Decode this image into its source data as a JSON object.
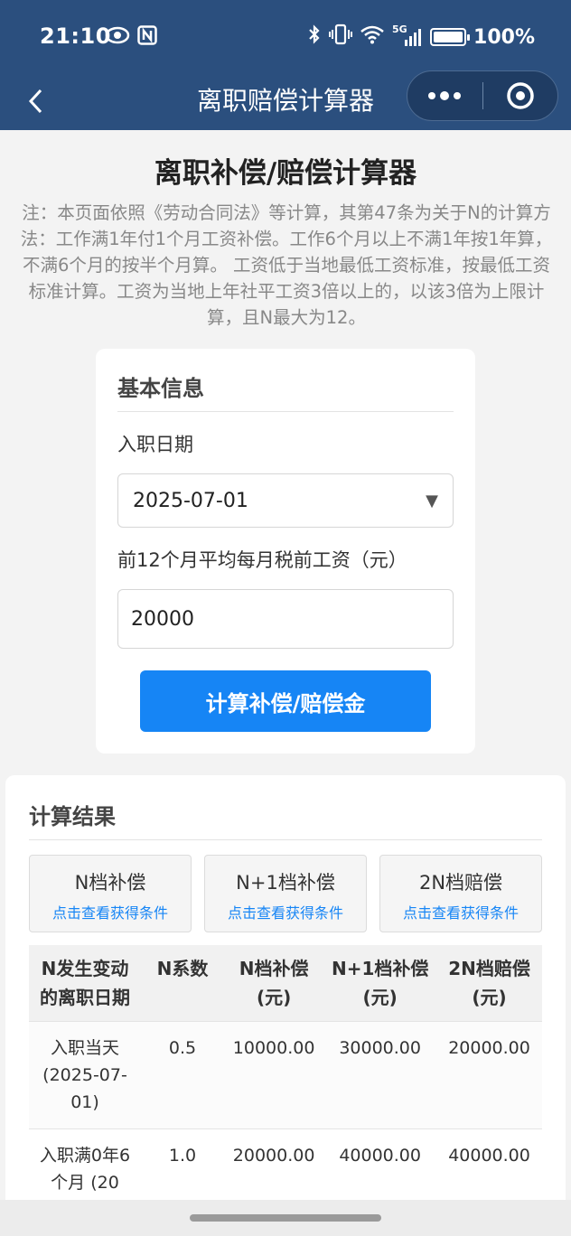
{
  "status_bar": {
    "time": "21:10",
    "network": "5G",
    "battery": "100%",
    "battery_level": 1.0,
    "icons": [
      "eye-icon",
      "nfc-icon",
      "bluetooth-icon",
      "vibrate-icon",
      "wifi-icon",
      "signal-icon",
      "battery-icon"
    ]
  },
  "nav": {
    "title": "离职赔偿计算器"
  },
  "page": {
    "title": "离职补偿/赔偿计算器",
    "note": "注：本页面依照《劳动合同法》等计算，其第47条为关于N的计算方法：工作满1年付1个月工资补偿。工作6个月以上不满1年按1年算，不满6个月的按半个月算。 工资低于当地最低工资标准，按最低工资标准计算。工资为当地上年社平工资3倍以上的，以该3倍为上限计算，且N最大为12。"
  },
  "basic": {
    "title": "基本信息",
    "hire_label": "入职日期",
    "hire_value": "2025-07-01",
    "salary_label": "前12个月平均每月税前工资（元）",
    "salary_value": "20000",
    "calc_button": "计算补偿/赔偿金"
  },
  "result": {
    "title": "计算结果",
    "tabs": [
      {
        "title": "N档补偿",
        "link": "点击查看获得条件"
      },
      {
        "title": "N+1档补偿",
        "link": "点击查看获得条件"
      },
      {
        "title": "2N档赔偿",
        "link": "点击查看获得条件"
      }
    ],
    "headers": [
      "N发生变动的离职日期",
      "N系数",
      "N档补偿(元)",
      "N+1档补偿(元)",
      "2N档赔偿(元)"
    ],
    "rows": [
      [
        "入职当天(2025-07-01)",
        "0.5",
        "10000.00",
        "30000.00",
        "20000.00"
      ],
      [
        "入职满0年6个月 (20",
        "1.0",
        "20000.00",
        "40000.00",
        "40000.00"
      ]
    ]
  },
  "colors": {
    "header_bg": "#2b4f7e",
    "primary_button": "#1685f5",
    "link": "#1685f5"
  }
}
